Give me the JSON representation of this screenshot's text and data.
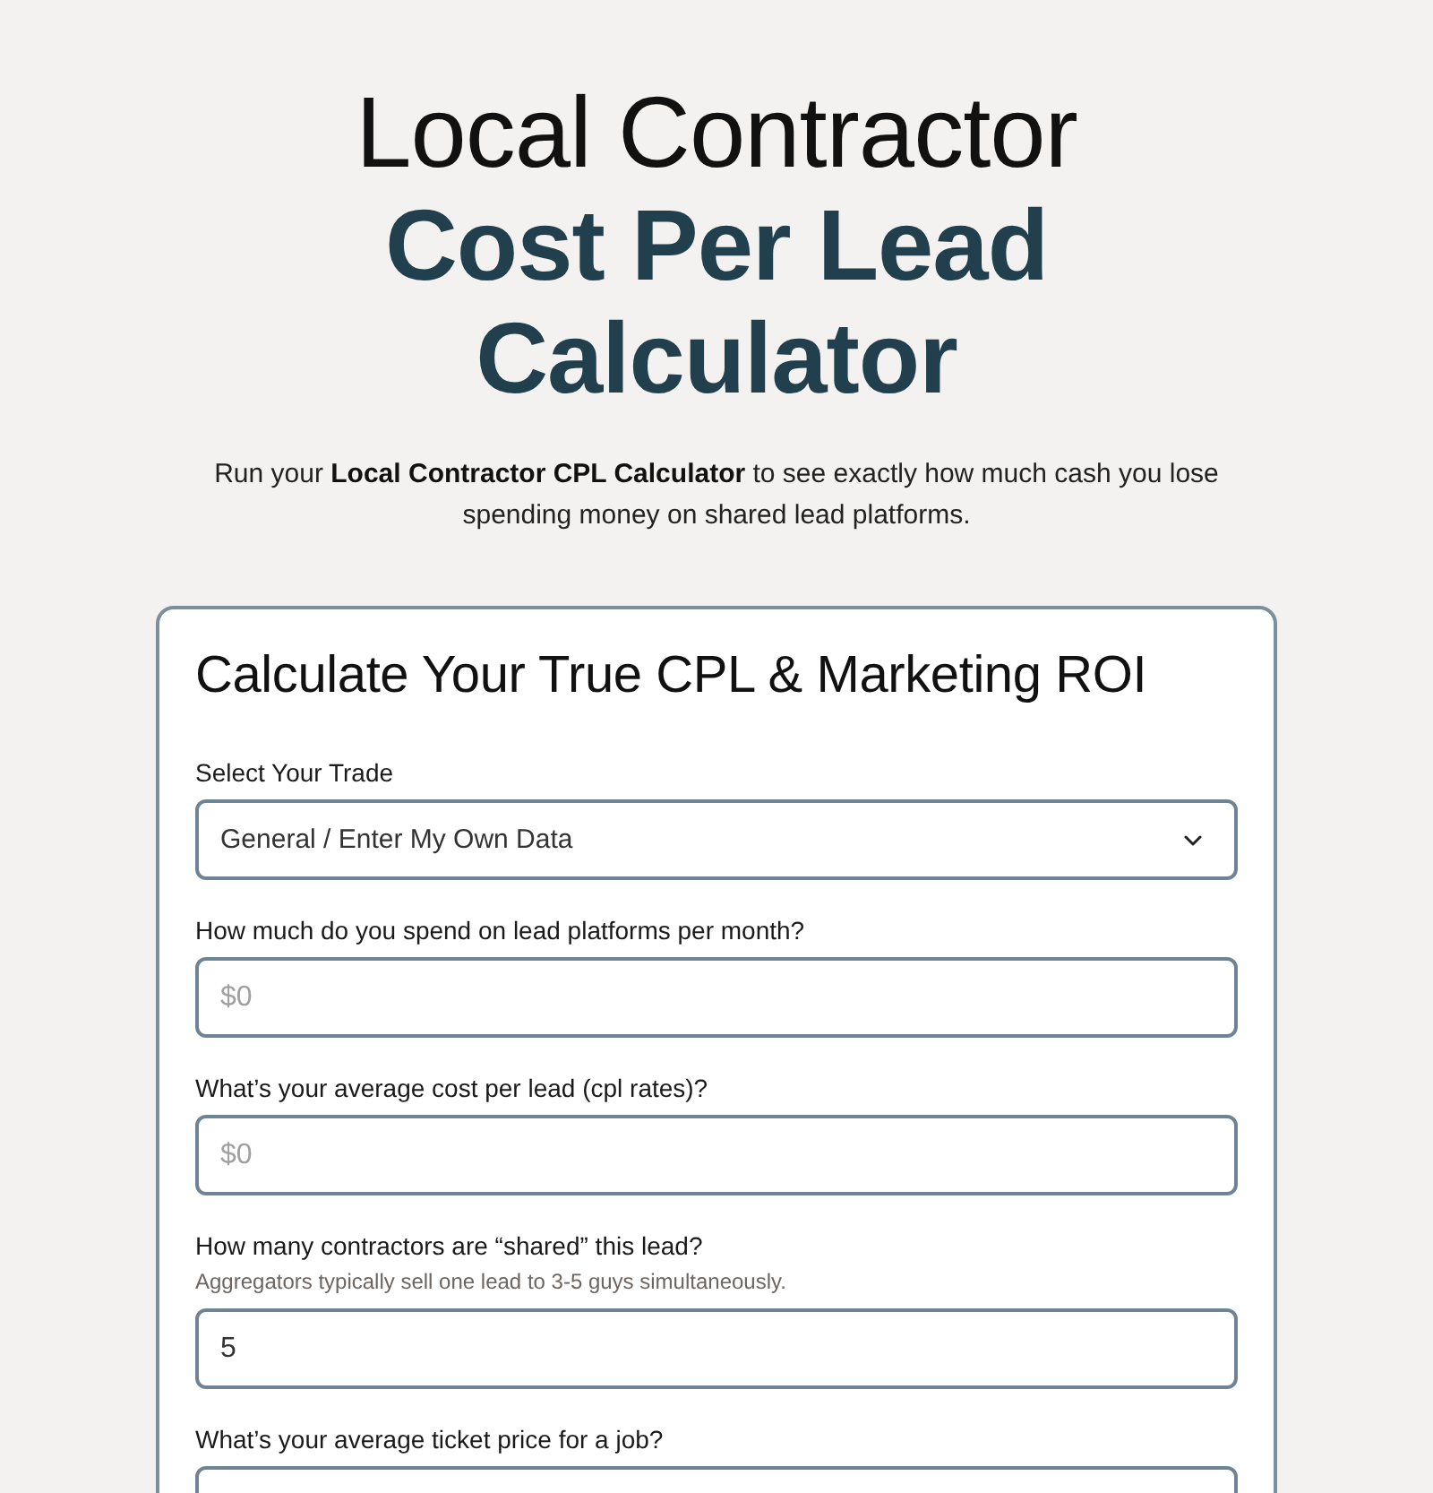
{
  "header": {
    "title": "Local Contractor **Cost Per Lead Calculator**",
    "subtitle": "Run your **Local Contractor CPL Calculator** to see exactly how much cash you lose spending money on shared lead platforms."
  },
  "calculator": {
    "heading": "Calculate Your True CPL & Marketing ROI",
    "fields": [
      {
        "kind": "select",
        "label": "Select Your Trade",
        "value": "General / Enter My Own Data"
      },
      {
        "kind": "input",
        "label": "How much do you spend on lead platforms per month?",
        "placeholder": "$0"
      },
      {
        "kind": "input",
        "label": "What’s your average cost per lead (cpl rates)?",
        "placeholder": "$0"
      },
      {
        "kind": "input",
        "label": "How many contractors are “shared” this lead?",
        "hint": "Aggregators typically sell one lead to 3-5 guys simultaneously.",
        "value": "5"
      },
      {
        "kind": "input",
        "label": "What’s your average ticket price for a job?"
      }
    ]
  }
}
